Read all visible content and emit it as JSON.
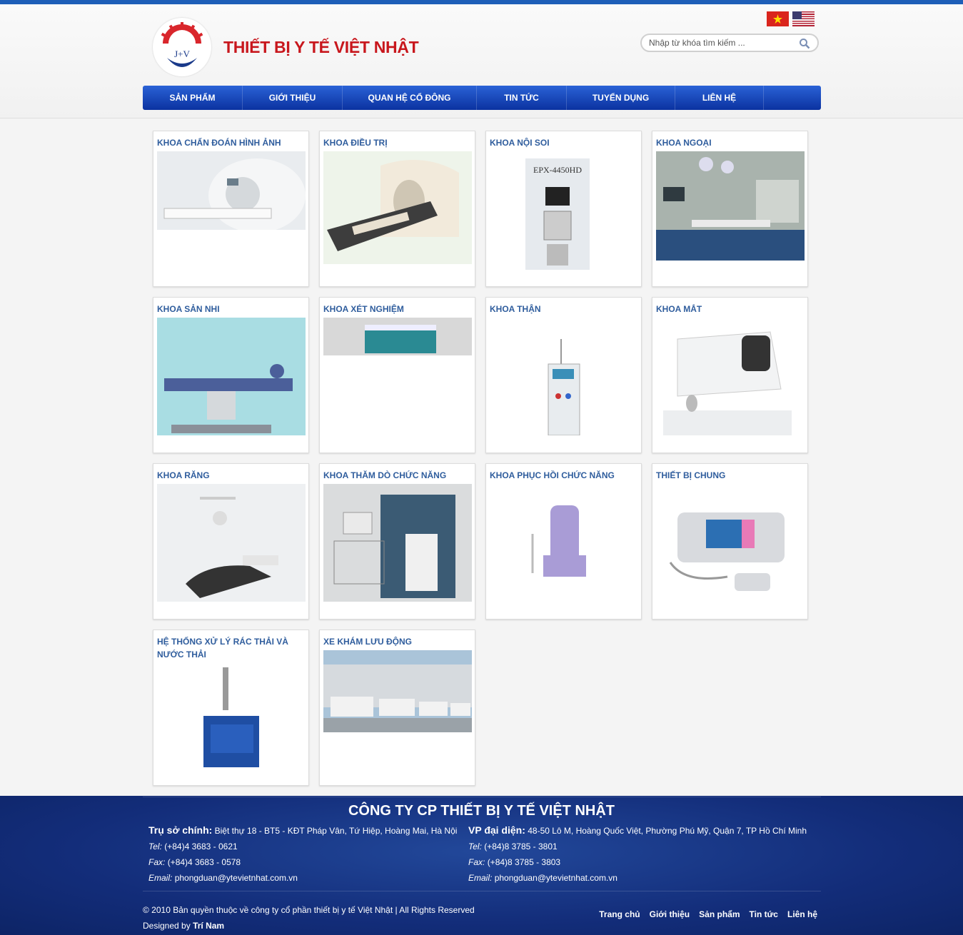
{
  "header": {
    "brand": "THIẾT BỊ Y TẾ VIỆT NHẬT",
    "logo_text": "J+V",
    "search_placeholder": "Nhập từ khóa tìm kiếm ..."
  },
  "nav": [
    {
      "label": "SẢN PHẨM"
    },
    {
      "label": "GIỚI THIỆU"
    },
    {
      "label": "QUAN HỆ CỔ ĐÔNG"
    },
    {
      "label": "TIN TỨC"
    },
    {
      "label": "TUYỂN DỤNG"
    },
    {
      "label": "LIÊN HỆ"
    }
  ],
  "categories": [
    {
      "title": "KHOA CHẨN ĐOÁN HÌNH ẢNH"
    },
    {
      "title": "KHOA ĐIỀU TRỊ"
    },
    {
      "title": "KHOA NỘI SOI",
      "image_text": "EPX-4450HD"
    },
    {
      "title": "KHOA NGOẠI"
    },
    {
      "title": "KHOA SẢN NHI"
    },
    {
      "title": "KHOA XÉT NGHIỆM"
    },
    {
      "title": "KHOA THẬN"
    },
    {
      "title": "KHOA MẮT"
    },
    {
      "title": "KHOA RĂNG"
    },
    {
      "title": "KHOA THĂM DÒ CHỨC NĂNG"
    },
    {
      "title": "KHOA PHỤC HỒI CHỨC NĂNG"
    },
    {
      "title": "THIẾT BỊ CHUNG"
    },
    {
      "title": "HỆ THỐNG XỬ LÝ RÁC THẢI VÀ NƯỚC THẢI"
    },
    {
      "title": "XE KHÁM LƯU ĐỘNG"
    }
  ],
  "footer": {
    "company": "CÔNG TY CP THIẾT BỊ Y TẾ VIỆT NHẬT",
    "hq_label": "Trụ sở chính:",
    "hq_address": "Biệt thự 18 - BT5 - KĐT Pháp Vân, Tứ Hiệp, Hoàng Mai, Hà Nội",
    "hq_tel_label": "Tel:",
    "hq_tel": "(+84)4 3683 - 0621",
    "hq_fax_label": "Fax:",
    "hq_fax": "(+84)4 3683 - 0578",
    "hq_email_label": "Email:",
    "hq_email": "phongduan@ytevietnhat.com.vn",
    "rep_label": "VP đại diện:",
    "rep_address": "48-50 Lô M, Hoàng Quốc Việt, Phường Phú Mỹ, Quận 7, TP Hồ Chí Minh",
    "rep_tel_label": "Tel:",
    "rep_tel": "(+84)8 3785 - 3801",
    "rep_fax_label": "Fax:",
    "rep_fax": "(+84)8 3785 - 3803",
    "rep_email_label": "Email:",
    "rep_email": "phongduan@ytevietnhat.com.vn",
    "copyright": "© 2010 Bản quyền thuộc về công ty cổ phần thiết bị y tế Việt Nhật  |  All Rights Reserved",
    "designed_by_label": "Designed by",
    "designer": "Trí Nam",
    "links": [
      "Trang chủ",
      "Giới thiệu",
      "Sản phẩm",
      "Tin tức",
      "Liên hệ"
    ]
  },
  "colors": {
    "brand_red": "#c8171d",
    "nav_blue": "#0b32a0",
    "title_blue": "#2f5d9d",
    "footer_blue": "#132d7a"
  }
}
